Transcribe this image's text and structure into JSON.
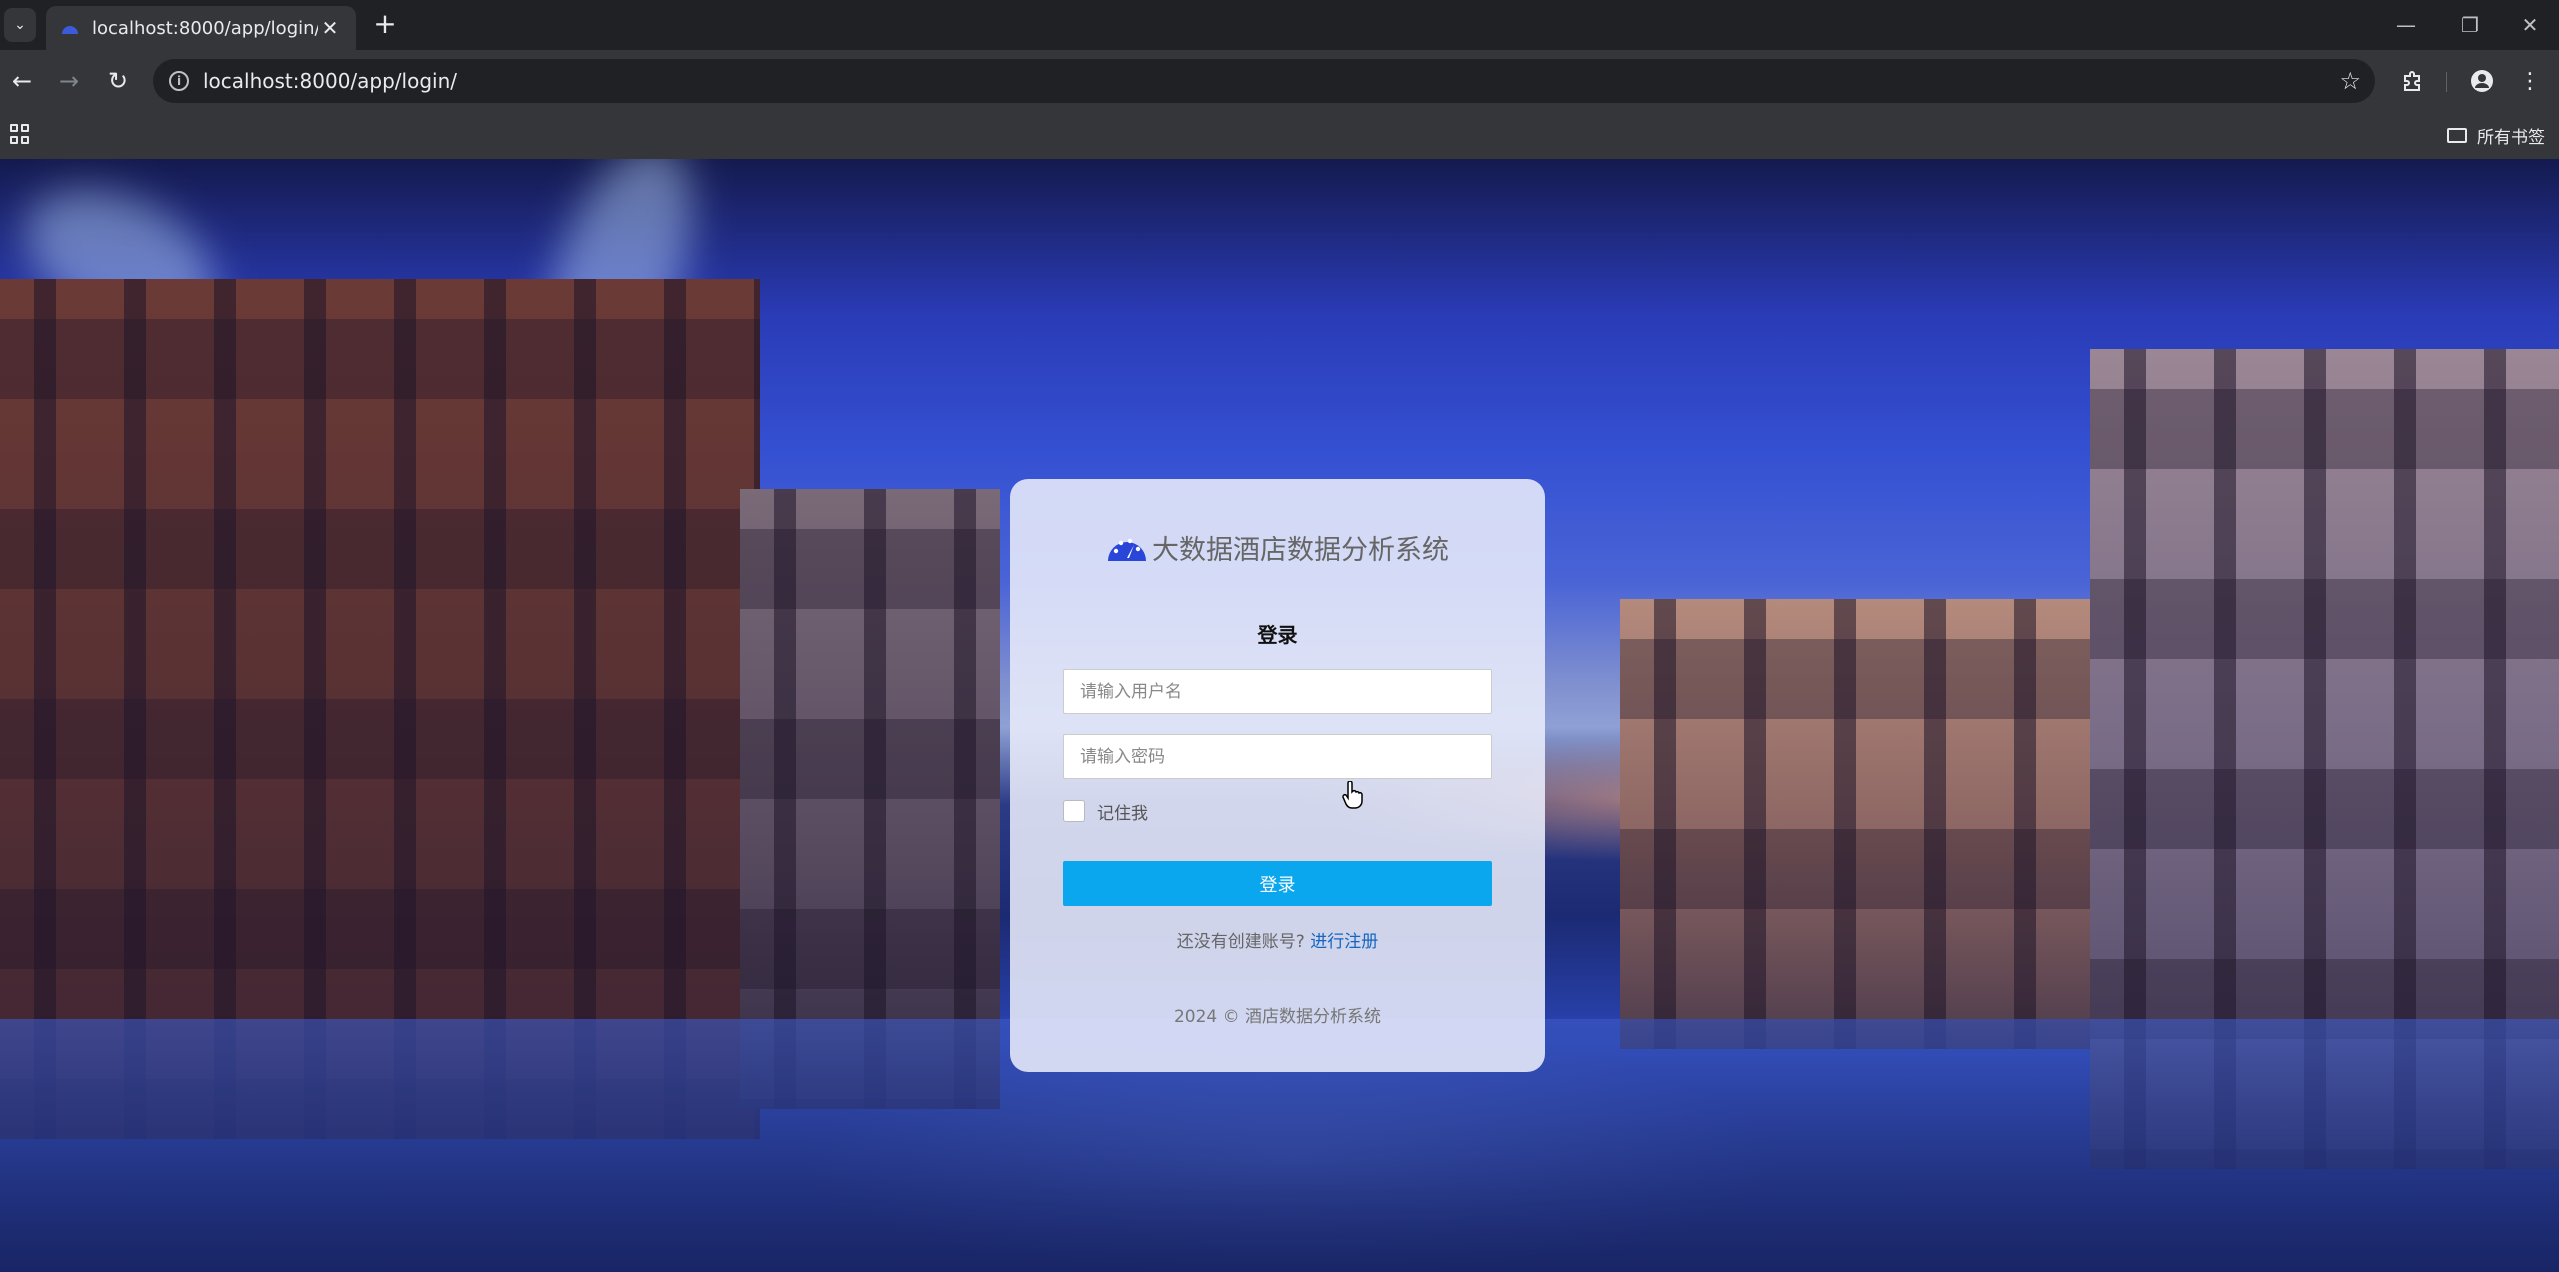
{
  "browser": {
    "tab_title": "localhost:8000/app/login/",
    "url": "localhost:8000/app/login/",
    "bookmarks_label": "所有书签",
    "new_tab_label": "+",
    "close_tab_label": "✕"
  },
  "login": {
    "brand": "大数据酒店数据分析系统",
    "title": "登录",
    "username_placeholder": "请输入用户名",
    "password_placeholder": "请输入密码",
    "remember_label": "记住我",
    "submit_label": "登录",
    "register_prompt": "还没有创建账号?",
    "register_link": "进行注册",
    "footer": "2024 © 酒店数据分析系统"
  },
  "colors": {
    "accent": "#0aa7ee",
    "brand_icon": "#2a46d8",
    "link": "#1565c0"
  },
  "icons": {
    "brand": "dashboard-gauge-icon",
    "cursor": "hand-pointer-icon"
  }
}
